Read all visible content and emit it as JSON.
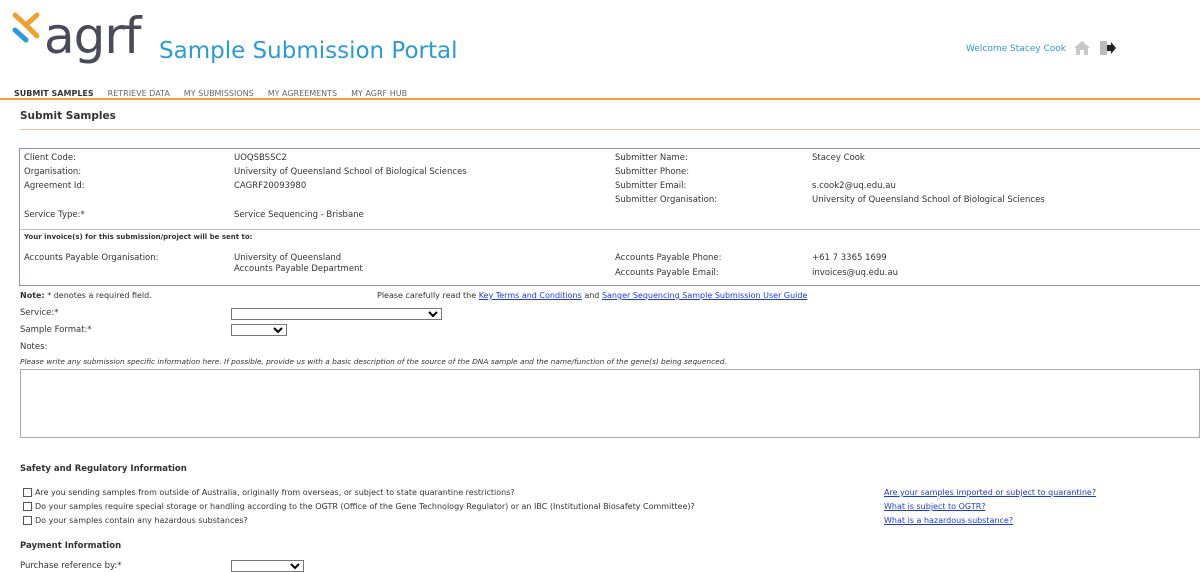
{
  "header": {
    "logo_text": "agrf",
    "portal_title": "Sample Submission Portal",
    "welcome": "Welcome Stacey Cook",
    "brand_orange": "#f0a030",
    "brand_blue": "#2a9bd6"
  },
  "nav": {
    "submit_samples": "SUBMIT SAMPLES",
    "retrieve_data": "RETRIEVE DATA",
    "my_submissions": "MY SUBMISSIONS",
    "my_agreements": "MY AGREEMENTS",
    "my_agrf_hub": "MY AGRF HUB"
  },
  "page_title": "Submit Samples",
  "info": {
    "client_code_label": "Client Code:",
    "client_code": "UOQSBSSC2",
    "organisation_label": "Organisation:",
    "organisation": "University of Queensland School of Biological Sciences",
    "agreement_label": "Agreement Id:",
    "agreement": "CAGRF20093980",
    "service_type_label": "Service Type:*",
    "service_type": "Service Sequencing - Brisbane",
    "submitter_name_label": "Submitter Name:",
    "submitter_name": "Stacey Cook",
    "submitter_phone_label": "Submitter Phone:",
    "submitter_email_label": "Submitter Email:",
    "submitter_email": "s.cook2@uq.edu.au",
    "submitter_org_label": "Submitter Organisation:",
    "submitter_org": "University of Queensland School of Biological Sciences",
    "invoice_note": "Your invoice(s) for this submission/project will be sent to:",
    "ap_org_label": "Accounts Payable Organisation:",
    "ap_org_line1": "University of Queensland",
    "ap_org_line2": "Accounts Payable Department",
    "ap_phone_label": "Accounts Payable Phone:",
    "ap_phone": "+61 7 3365 1699",
    "ap_email_label": "Accounts Payable Email:",
    "ap_email": "invoices@uq.edu.au"
  },
  "notice": {
    "note_label": "Note:",
    "required_text": "* denotes a required field.",
    "read_prefix": "Please carefully read the",
    "terms_link": "Key Terms and Conditions",
    "and": "and",
    "guide_link": "Sanger Sequencing Sample Submission User Guide"
  },
  "form": {
    "service_label": "Service:*",
    "service_value": "",
    "format_label": "Sample Format:*",
    "format_value": "",
    "notes_label": "Notes:",
    "notes_hint": "Please write any submission specific information here. If possible, provide us with a basic description of the source of the DNA sample and the name/function of the gene(s) being sequenced."
  },
  "safety": {
    "title": "Safety and Regulatory Information",
    "q1": "Are you sending samples from outside of Australia, originally from overseas, or subject to state quarantine restrictions?",
    "q2": "Do your samples require special storage or handling according to the OGTR (Office of the Gene Technology Regulator) or an IBC (Institutional Biosafety Committee)?",
    "q3": "Do your samples contain any hazardous substances?",
    "link1": "Are your samples imported or subject to quarantine?",
    "link2": "What is subject to OGTR?",
    "link3": "What is a hazardous substance?"
  },
  "payment": {
    "title": "Payment Information",
    "purchase_label": "Purchase reference by:*",
    "purchase_value": ""
  }
}
